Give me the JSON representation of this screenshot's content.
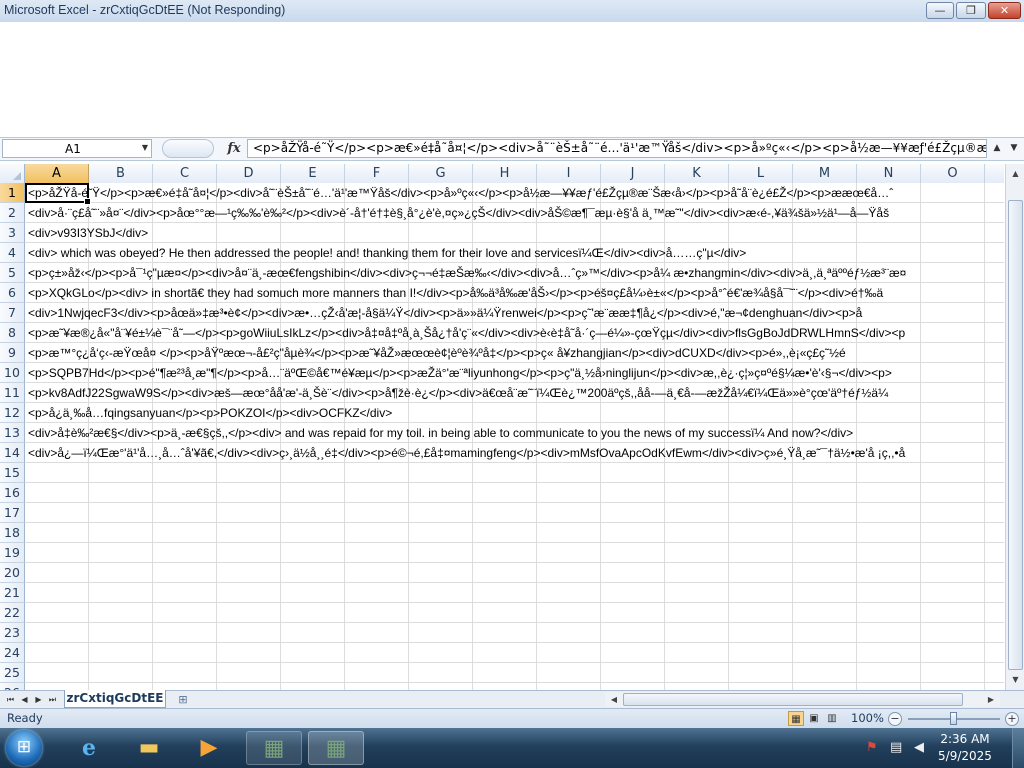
{
  "window": {
    "title": "Microsoft Excel - zrCxtiqGcDtEE (Not Responding)",
    "minimize": "—",
    "maximize": "❐",
    "close": "✕"
  },
  "formula_bar": {
    "name_box": "A1",
    "fx": "fx",
    "formula": "<p>åŽŸå-é˜Ÿ</p><p>æ€»é‡å˜å¤¦</p><div>å˜¨èŠ±å˜¨é…'ä¹'æ™Ÿåš</div><p>å»ºç«‹</p><p>å½æ—¥¥æƒ'é£Žçµ®æ¨Šæ‹å›</"
  },
  "columns": [
    "A",
    "B",
    "C",
    "D",
    "E",
    "F",
    "G",
    "H",
    "I",
    "J",
    "K",
    "L",
    "M",
    "N",
    "O"
  ],
  "rows": [
    "1",
    "2",
    "3",
    "4",
    "5",
    "6",
    "7",
    "8",
    "9",
    "10",
    "11",
    "12",
    "13",
    "14",
    "15",
    "16",
    "17",
    "18",
    "19",
    "20",
    "21",
    "22",
    "23",
    "24",
    "25",
    "26"
  ],
  "cells": [
    "<p>åŽŸå-é˜Ÿ</p><p>æ€»é‡å˜å¤¦</p><div>å˜¨èŠ±å˜¨é…'ä¹'æ™Ÿåš</div><p>å»ºç«‹</p><p>å½æ—¥¥æƒ'é£Žçµ®æ¨Šæ‹å›</p><p>å˜å¨è¿é£Ž</p><p>ææœ€å…ˆ",
    "<div>å·¨ç£å˜¨»å¤¨</div><p>åœ°°æ—¹ç‰‰'è‰²</p><div>è´-å†'é†‡è§¸å°¿è'è,¤ç»¿çŠ</div><div>åŠ©æ¶¯æµ·è§'å ä¸™æ˜\"</div><div>æ‹é-,¥ä¾šä»½ä¹—å—Ÿåš",
    "<div>v93I3YSbJ</div>",
    "<div> which was obeyed? He then addressed the people! and! thanking them for their love and servicesï¼Œ</div><div>å……ç\"µ</div>",
    "<p>ç±»åž‹</p><p>å¯¹ç\"µæ¤</p><div>å¤¨ä¸-æœ€fengshibin</div><div>ç¬¬é‡æŠæ‰‹</div><div>å…ˆç»™</div><p>å¼ æ•zhangmin</div><div>ä¸,ä¸ªäººéƒ½æ³¨æ¤",
    "<p>XQkGLo</p><div> in shortã€ they had somuch more manners than I!</div><p>å‰ä³å‰æ'åŠ›</p><p>éš¤ç£å¼›è±«</p><p>å°ˆé€'æ¾å§å¯˜¨</p><div>é†‰ä",
    "<div>1NwjqecF3</div><p>åœä»‡æ³•è¢</p><div>æ•…çŽ‹å'æ¦-å§ä¼Ÿ</div><p>ä»»ä¼Ÿrenwei</p><p>ç˜'æ¨ææ‡¶å¿</p><div>é,\"æ¬¢denghuan</div><p>å",
    "<p>æ˜¥æ®¿å«\"å¨¥é±¼è¯¨å˜—</p><p>goWiiuLsIkLz</p><div>å‡¤å‡ºå¸à¸Šå¿†å'ç¨«</div><div>è‹è‡å˜å·´ç—é¼»-çœŸçµ</div><div>flsGgBoJdDRWLHmnS</div><p",
    "<p>æ™°ç¿å‘ç‹-æŸœå¤ </p><p>åŸºæœ¬-å£²ç\"åµè¾</p><p>æ˜¥åŽ»æœœè¢¦èºè¾ºå‡</p><p>ç« å¥zhangjian</p><div>dCUXD</div><p>é»,,è¡«ç£ç˜½é",
    "<p>SQPB7Hd</p><p>é\"¶æ²³å¸æ\"¶</p><p>å…¨äºŒ©å€™é¥æµ</p><p>æŽä°'æ¨ªliyunhong</p><p>ç\"ä¸½å›ninglijun</p><div>æ,,è¿·ç¦»ç¤ºé§¼æ•'è'‹§¬</div><p>",
    "<p>kv8AdfJ22SgwaW9S</p><div>æš—æœ°åå'æ'-ä¸Šè¨</div><p>å¶žè·è¿</p><div>ä€œå¨æ˜¨ï¼Œè¿™200äºçš,,åå-—ä¸€å-—æžŽå¼€ï¼Œä»»è°çœ'äº†éƒ½ä¼",
    "<p>å¿ä¸‰å…fqingsanyuan</p><p>POKZOI</p><div>OCFKZ</div>",
    "<div>å‡è‰²æ€§</div><p>ä¸-æ€§çš,,</p><div> and was repaid for my toil. in being able to communicate to you the news of my successï¼ And now?</div>",
    "<div>å¿—ï¼Œæ°'ä¹'å…¸å…ˆå'¥ã€,</div><div>ç›¸ä½å¸¸é‡</div><p>é©¬é,£å‡¤mamingfeng</p><div>mMsfOvaApcOdKvfEwm</div><div>ç»é¸Ÿå¸æ˜¯†ä½•æ'å ¡ç,,•å"
  ],
  "sheet_tab": "zrCxtiqGcDtEE",
  "status": {
    "ready": "Ready",
    "zoom": "100%"
  },
  "taskbar": {
    "time": "2:36 AM",
    "date": "5/9/2025"
  }
}
